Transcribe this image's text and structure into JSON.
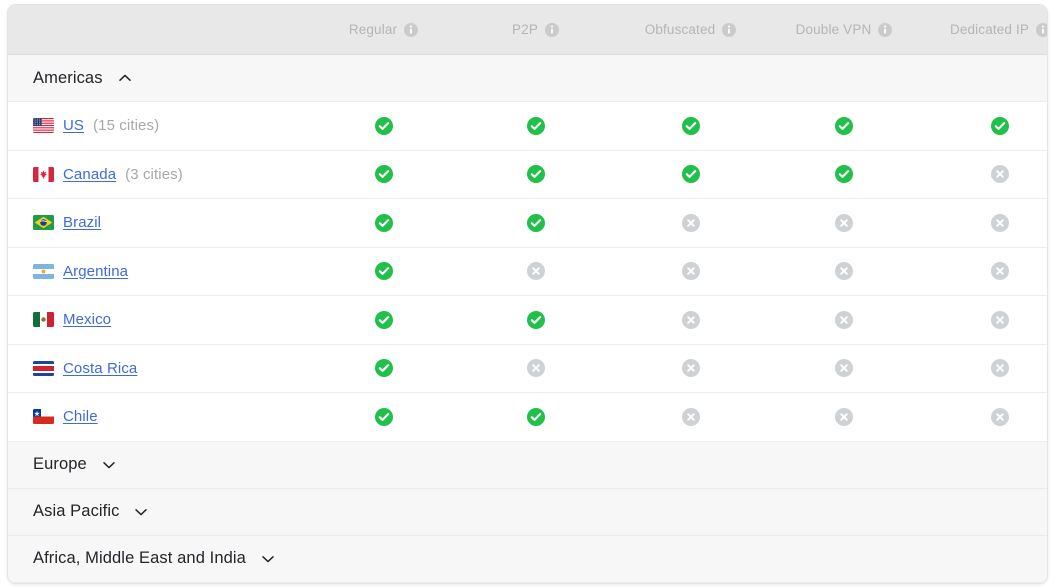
{
  "table": {
    "columns": [
      {
        "label": "Regular",
        "info_icon": "info-icon"
      },
      {
        "label": "P2P",
        "info_icon": "info-icon"
      },
      {
        "label": "Obfuscated",
        "info_icon": "info-icon"
      },
      {
        "label": "Double VPN",
        "info_icon": "info-icon"
      },
      {
        "label": "Dedicated IP",
        "info_icon": "info-icon"
      }
    ],
    "colors": {
      "available": "#21c04b",
      "unavailable": "#cfd2d4",
      "link": "#3e6ae1",
      "header_bg": "#e8e8e8",
      "section_bg": "#f7f7f7",
      "header_text": "#b3b5b8"
    },
    "sections": [
      {
        "name": "Americas",
        "expanded": true,
        "chevron": "chevron-up-icon",
        "countries": [
          {
            "name": "US",
            "cities": "(15 cities)",
            "flag": "flag-us",
            "support": [
              true,
              true,
              true,
              true,
              true
            ]
          },
          {
            "name": "Canada",
            "cities": "(3 cities)",
            "flag": "flag-ca",
            "support": [
              true,
              true,
              true,
              true,
              false
            ]
          },
          {
            "name": "Brazil",
            "cities": "",
            "flag": "flag-br",
            "support": [
              true,
              true,
              false,
              false,
              false
            ]
          },
          {
            "name": "Argentina",
            "cities": "",
            "flag": "flag-ar",
            "support": [
              true,
              false,
              false,
              false,
              false
            ]
          },
          {
            "name": "Mexico",
            "cities": "",
            "flag": "flag-mx",
            "support": [
              true,
              true,
              false,
              false,
              false
            ]
          },
          {
            "name": "Costa Rica",
            "cities": "",
            "flag": "flag-cr",
            "support": [
              true,
              false,
              false,
              false,
              false
            ]
          },
          {
            "name": "Chile",
            "cities": "",
            "flag": "flag-cl",
            "support": [
              true,
              true,
              false,
              false,
              false
            ]
          }
        ]
      },
      {
        "name": "Europe",
        "expanded": false,
        "chevron": "chevron-down-icon",
        "countries": []
      },
      {
        "name": "Asia Pacific",
        "expanded": false,
        "chevron": "chevron-down-icon",
        "countries": []
      },
      {
        "name": "Africa, Middle East and India",
        "expanded": false,
        "chevron": "chevron-down-icon",
        "countries": []
      }
    ]
  }
}
